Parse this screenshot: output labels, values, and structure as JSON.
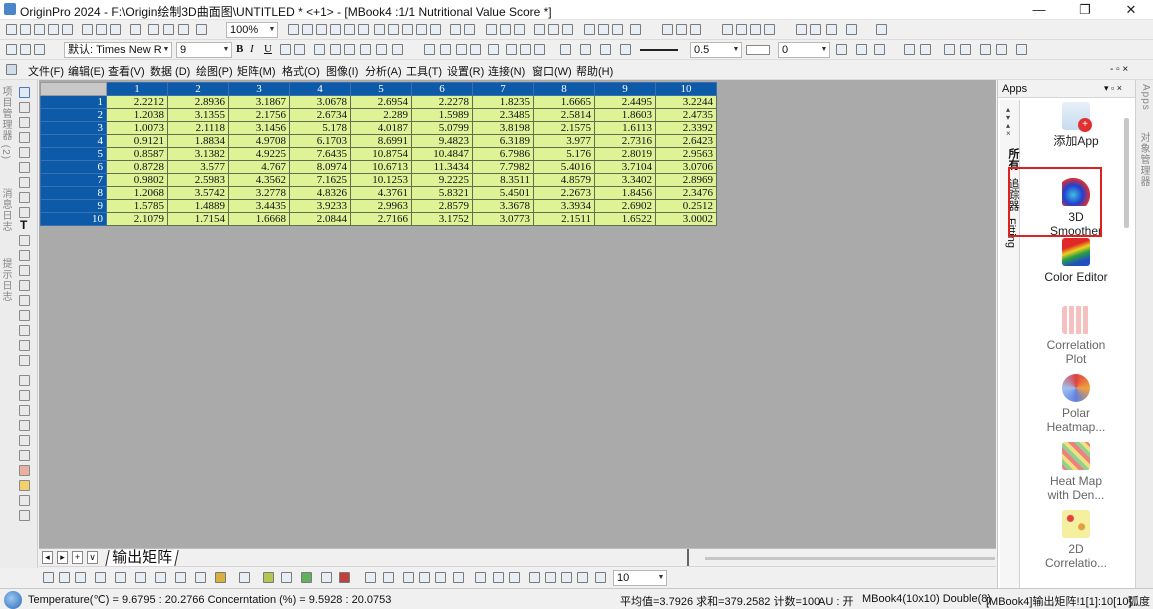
{
  "window": {
    "title": "OriginPro 2024 - F:\\Origin绘制3D曲面图\\UNTITLED * <+1> - [MBook4 :1/1 Nutritional Value Score *]",
    "minimize": "—",
    "restore": "❐",
    "close": "✕"
  },
  "toolbar": {
    "zoom": "100%",
    "font_name": "默认: Times New R",
    "font_size": "9",
    "bold": "B",
    "italic": "I",
    "underline": "U",
    "line_width": "0.5",
    "fill_value": "0"
  },
  "menu": {
    "items": [
      "文件(F)",
      "编辑(E)",
      "查看(V)",
      "数据 (D)",
      "绘图(P)",
      "矩阵(M)",
      "格式(O)",
      "图像(I)",
      "分析(A)",
      "工具(T)",
      "设置(R)",
      "连接(N)",
      "窗口(W)",
      "帮助(H)"
    ],
    "mdi_controls": "- ▫ ×"
  },
  "left_panel": {
    "project_manager": "项目管理器 (2)",
    "message_log": "消息日志",
    "hint_log": "提示日志"
  },
  "matrix": {
    "column_headers": [
      "1",
      "2",
      "3",
      "4",
      "5",
      "6",
      "7",
      "8",
      "9",
      "10"
    ],
    "row_headers": [
      "1",
      "2",
      "3",
      "4",
      "5",
      "6",
      "7",
      "8",
      "9",
      "10"
    ],
    "rows": [
      [
        "2.2212",
        "2.8936",
        "3.1867",
        "3.0678",
        "2.6954",
        "2.2278",
        "1.8235",
        "1.6665",
        "2.4495",
        "3.2244"
      ],
      [
        "1.2038",
        "3.1355",
        "2.1756",
        "2.6734",
        "2.289",
        "1.5989",
        "2.3485",
        "2.5814",
        "1.8603",
        "2.4735"
      ],
      [
        "1.0073",
        "2.1118",
        "3.1456",
        "5.178",
        "4.0187",
        "5.0799",
        "3.8198",
        "2.1575",
        "1.6113",
        "2.3392"
      ],
      [
        "0.9121",
        "1.8834",
        "4.9708",
        "6.1703",
        "8.6991",
        "9.4823",
        "6.3189",
        "3.977",
        "2.7316",
        "2.6423"
      ],
      [
        "0.8587",
        "3.1382",
        "4.9225",
        "7.6435",
        "10.8754",
        "10.4847",
        "6.7986",
        "5.176",
        "2.8019",
        "2.9563"
      ],
      [
        "0.8728",
        "3.577",
        "4.767",
        "8.0974",
        "10.6713",
        "11.3434",
        "7.7982",
        "5.4016",
        "3.7104",
        "3.0706"
      ],
      [
        "0.9802",
        "2.5983",
        "4.3562",
        "7.1625",
        "10.1253",
        "9.2225",
        "8.3511",
        "4.8579",
        "3.3402",
        "2.8969"
      ],
      [
        "1.2068",
        "3.5742",
        "3.2778",
        "4.8326",
        "4.3761",
        "5.8321",
        "5.4501",
        "2.2673",
        "1.8456",
        "2.3476"
      ],
      [
        "1.5785",
        "1.4889",
        "3.4435",
        "3.9233",
        "2.9963",
        "2.8579",
        "3.3678",
        "3.3934",
        "2.6902",
        "0.2512"
      ],
      [
        "2.1079",
        "1.7154",
        "1.6668",
        "2.0844",
        "2.7166",
        "3.1752",
        "3.0773",
        "2.1511",
        "1.6522",
        "3.0002"
      ]
    ]
  },
  "sheet_tabs": {
    "prev": "◂",
    "next": "▸",
    "add": "+",
    "menu": "∨",
    "active_tab": "输出矩阵"
  },
  "bottom_toolbar": {
    "value_box": "10"
  },
  "status": {
    "left": "Temperature(℃) = 9.6795 : 20.2766  Concerntation  (%)  = 9.5928 : 20.0753",
    "stats": "平均值=3.7926 求和=379.2582 计数=100",
    "au": "AU : 开",
    "book_info": "MBook4(10x10) Double(8)",
    "selection": "[MBook4]输出矩阵!1[1]:10[10]",
    "angle": "弧度"
  },
  "apps_panel": {
    "title": "Apps",
    "header_controls": "▾ ▫ ×",
    "vertical_tabs": [
      "所有",
      "追踪器",
      "Fitting"
    ],
    "items": [
      {
        "label": "添加App",
        "label2": "",
        "icon": "add-app-icon"
      },
      {
        "label": "3D",
        "label2": "Smoother",
        "icon": "3d-smoother-icon"
      },
      {
        "label": "Color Editor",
        "label2": "",
        "icon": "color-editor-icon"
      },
      {
        "label": "Correlation",
        "label2": "Plot",
        "icon": "correlation-plot-icon"
      },
      {
        "label": "Polar",
        "label2": "Heatmap...",
        "icon": "polar-heatmap-icon"
      },
      {
        "label": "Heat Map",
        "label2": "with Den...",
        "icon": "heat-map-icon"
      },
      {
        "label": "2D",
        "label2": "Correlatio...",
        "icon": "2d-correlation-icon"
      }
    ]
  },
  "right_strip": {
    "apps": "Apps",
    "object_manager": "对象管理器"
  },
  "colors": {
    "header_blue": "#0d5aa8",
    "cell_yellow": "#e0f296",
    "workspace_gray": "#aaaaaa",
    "highlight_red": "#e01f1f"
  }
}
